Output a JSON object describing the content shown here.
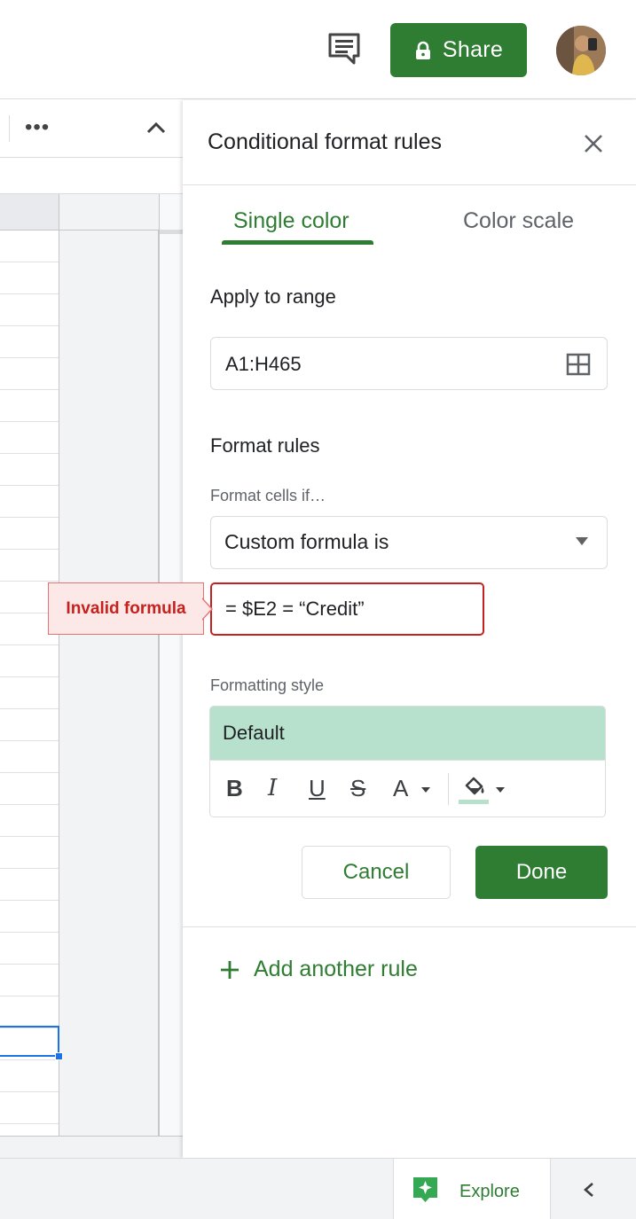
{
  "header": {
    "share_label": "Share",
    "icons": [
      "comment-icon",
      "lock-icon",
      "avatar"
    ]
  },
  "toolbar": {
    "more_label": "•••",
    "icons": [
      "more-icon",
      "collapse-up-icon"
    ]
  },
  "panel": {
    "title": "Conditional format rules",
    "tabs": [
      {
        "label": "Single color",
        "active": true
      },
      {
        "label": "Color scale",
        "active": false
      }
    ],
    "apply_to_range": {
      "label": "Apply to range",
      "value": "A1:H465"
    },
    "format_rules": {
      "heading": "Format rules",
      "condition_label": "Format cells if…",
      "condition_value": "Custom formula is",
      "formula_value": "= $E2 = “Credit”",
      "error_text": "Invalid formula"
    },
    "formatting_style": {
      "label": "Formatting style",
      "preview_text": "Default",
      "preview_color": "#b7e1cd",
      "tools": {
        "bold": "B",
        "italic": "I",
        "underline": "U",
        "strikethrough": "S",
        "text_color": "A"
      }
    },
    "buttons": {
      "cancel": "Cancel",
      "done": "Done"
    },
    "add_rule": "Add another rule"
  },
  "bottombar": {
    "explore_label": "Explore"
  },
  "colors": {
    "accent_green": "#2e7d32",
    "error_red": "#c5221f",
    "selection_blue": "#1a73e8"
  }
}
